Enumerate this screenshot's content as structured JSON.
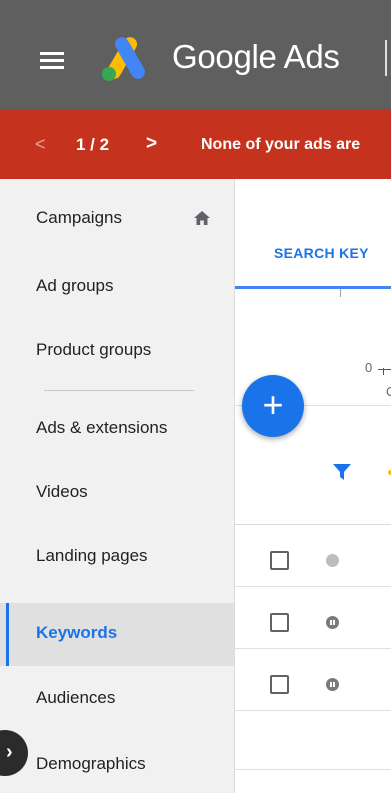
{
  "header": {
    "brand": "Google Ads",
    "menu_icon": "hamburger-menu-icon",
    "logo_icon": "google-ads-logo",
    "colors": {
      "background": "#5f5f5f",
      "logo_blue": "#4285f4",
      "logo_yellow": "#fbbc04"
    }
  },
  "alert": {
    "pager_prev": "<",
    "pager_count": "1 / 2",
    "pager_next": ">",
    "message": "None of your ads are",
    "colors": {
      "background": "#c5331f"
    }
  },
  "sidebar": {
    "items": [
      {
        "label": "Campaigns",
        "icon": "home-icon"
      },
      {
        "label": "Ad groups"
      },
      {
        "label": "Product groups"
      },
      {
        "label": "Ads & extensions"
      },
      {
        "label": "Videos"
      },
      {
        "label": "Landing pages"
      },
      {
        "label": "Keywords",
        "active": true
      },
      {
        "label": "Audiences"
      },
      {
        "label": "Demographics"
      }
    ],
    "accent": "#1a73e8"
  },
  "main": {
    "tab_label": "SEARCH KEY",
    "chart": {
      "y_tick": "0",
      "x_tick": "Oc"
    },
    "filter_icon": "filter-icon",
    "rows": [
      {
        "status": "grey-dot-icon"
      },
      {
        "status": "paused-icon"
      },
      {
        "status": "paused-icon"
      }
    ]
  },
  "fab": {
    "label": "+",
    "icon": "add-icon"
  },
  "collapse": {
    "label": "›",
    "icon": "chevron-right-icon"
  }
}
